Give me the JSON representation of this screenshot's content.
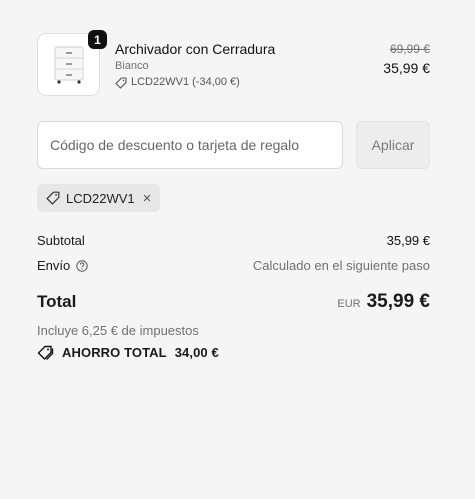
{
  "product": {
    "quantity": "1",
    "name": "Archivador con Cerradura",
    "variant": "Bianco",
    "discount_line": "LCD22WV1 (-34,00 €)",
    "price_original": "69,99 €",
    "price_final": "35,99 €"
  },
  "discount": {
    "placeholder": "Código de descuento o tarjeta de regalo",
    "value": "",
    "apply_label": "Aplicar",
    "applied_code": "LCD22WV1",
    "remove_symbol": "×"
  },
  "summary": {
    "subtotal_label": "Subtotal",
    "subtotal_value": "35,99 €",
    "shipping_label": "Envío",
    "shipping_value": "Calculado en el siguiente paso",
    "total_label": "Total",
    "currency": "EUR",
    "total_value": "35,99 €",
    "tax_note": "Incluye 6,25 € de impuestos",
    "savings_label": "AHORRO TOTAL",
    "savings_value": "34,00 €"
  },
  "icons": {
    "tag": "tag-icon",
    "help": "help-circle-icon",
    "savings": "double-tag-icon"
  }
}
